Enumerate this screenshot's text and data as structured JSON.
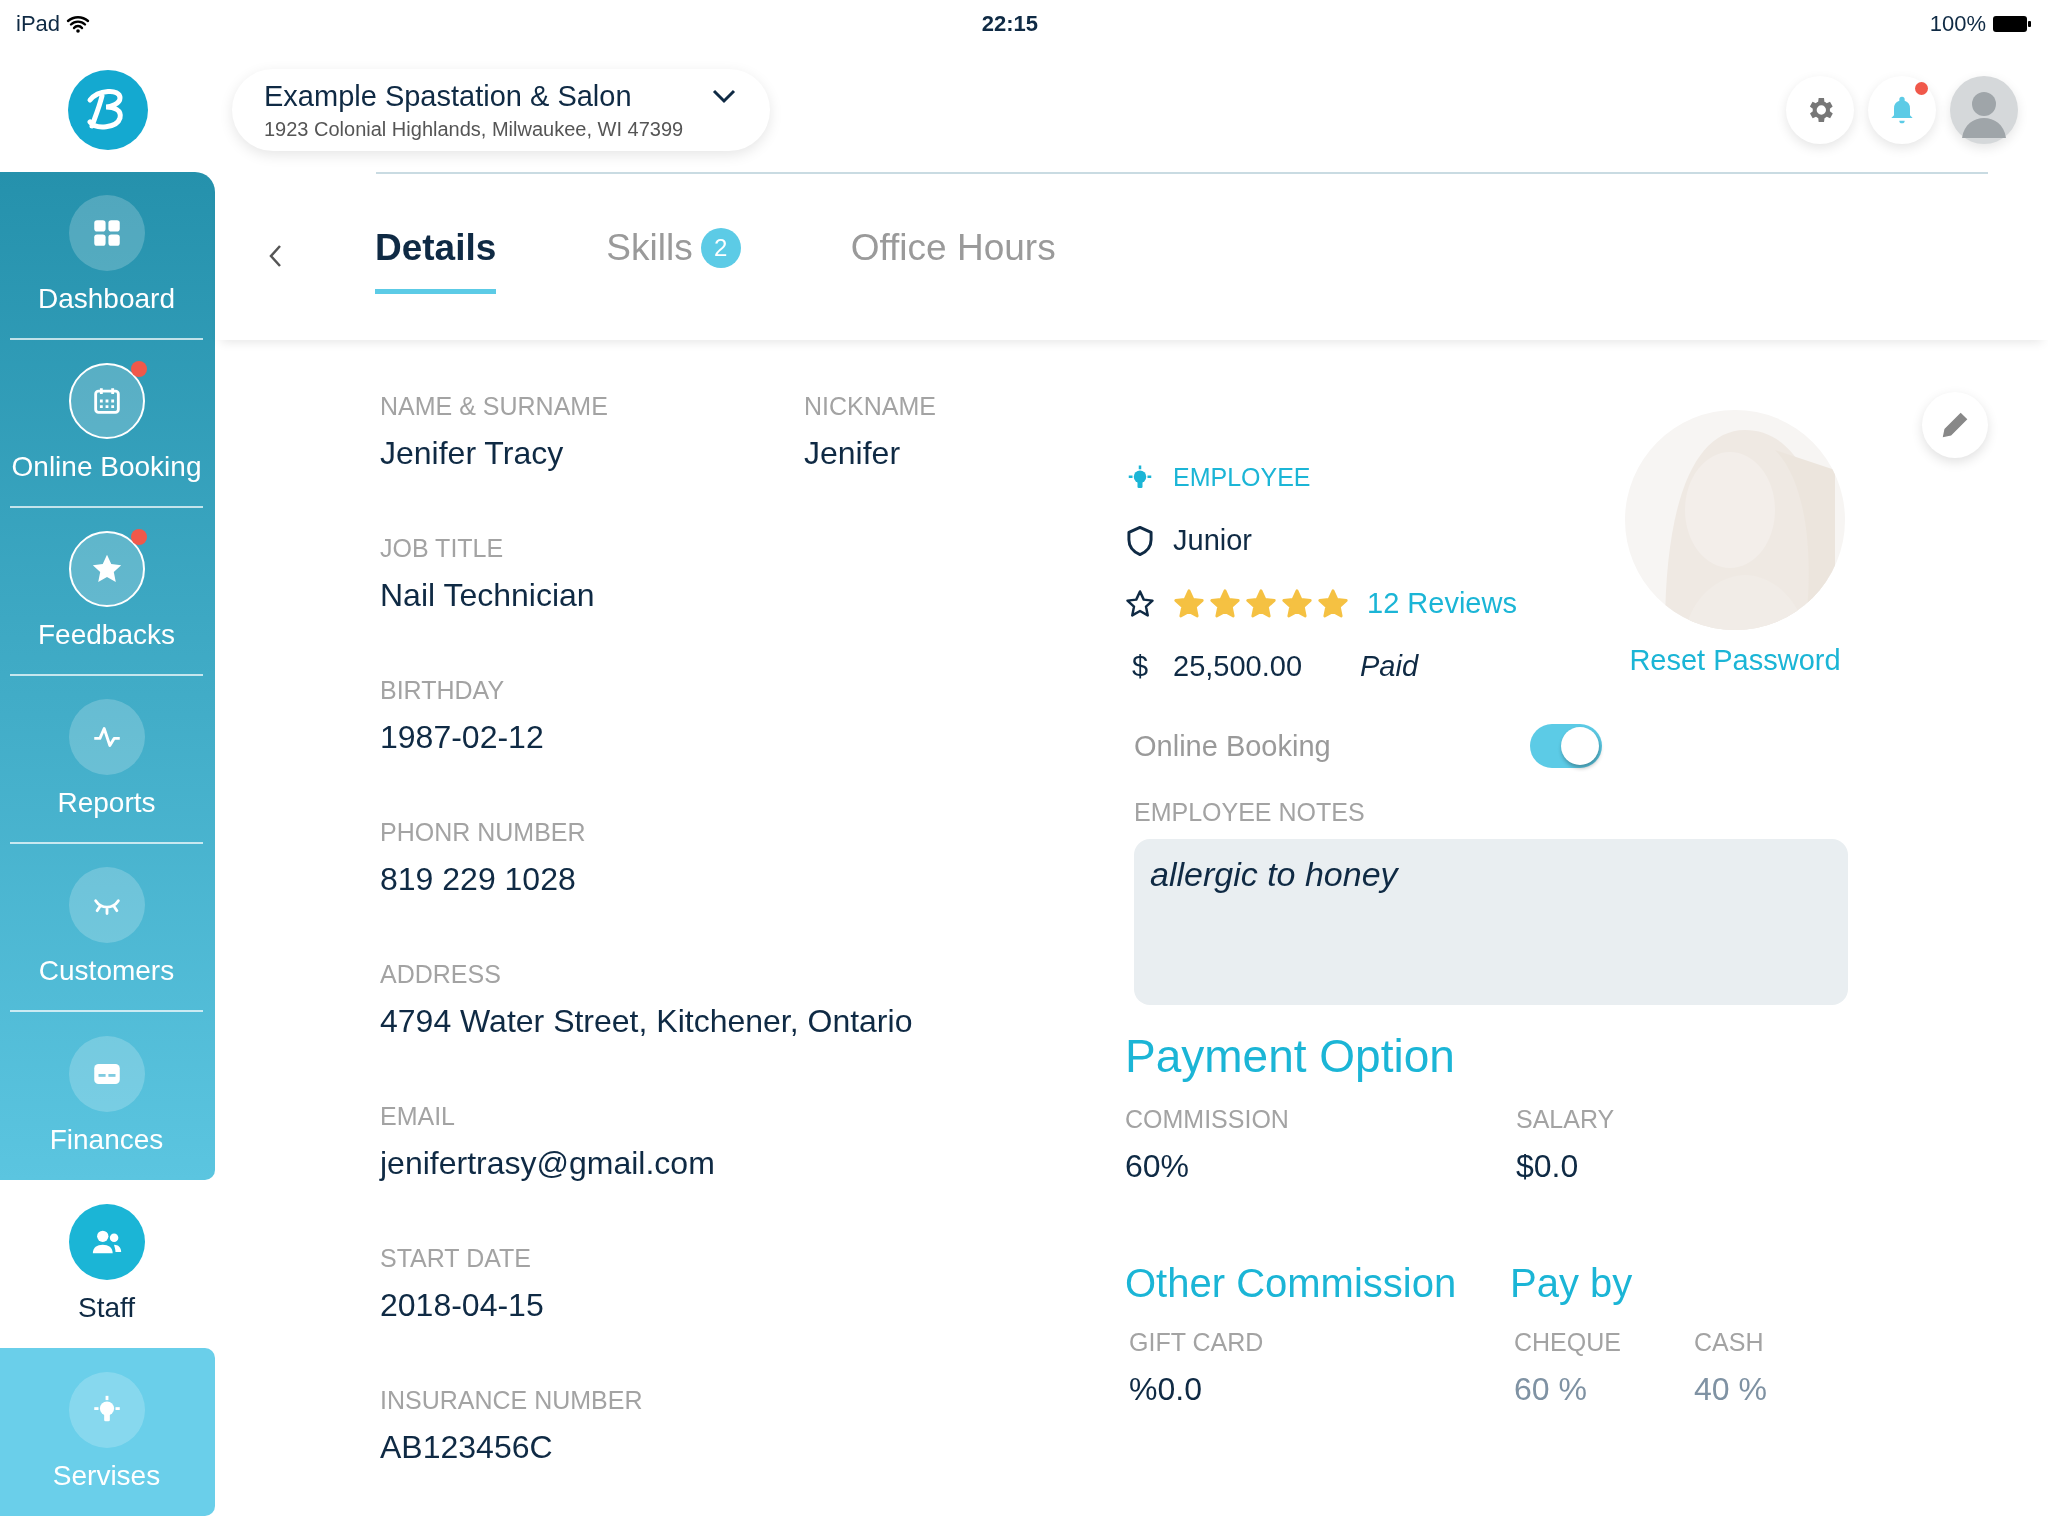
{
  "status_bar": {
    "device": "iPad",
    "time": "22:15",
    "battery": "100%"
  },
  "business": {
    "name": "Example Spastation & Salon",
    "address": "1923 Colonial Highlands, Milwaukee, WI 47399"
  },
  "header": {
    "notifications": true
  },
  "sidebar": {
    "items": [
      {
        "label": "Dashboard",
        "selected": false,
        "notification": false
      },
      {
        "label": "Online Booking",
        "selected": false,
        "notification": true
      },
      {
        "label": "Feedbacks",
        "selected": false,
        "notification": true
      },
      {
        "label": "Reports",
        "selected": false,
        "notification": false
      },
      {
        "label": "Customers",
        "selected": false,
        "notification": false
      },
      {
        "label": "Finances",
        "selected": false,
        "notification": false
      },
      {
        "label": "Staff",
        "selected": true,
        "notification": false
      },
      {
        "label": "Servises",
        "selected": false,
        "notification": false
      }
    ]
  },
  "tabs": [
    {
      "label": "Details",
      "selected": true
    },
    {
      "label": "Skills",
      "selected": false,
      "badge": "2"
    },
    {
      "label": "Office Hours",
      "selected": false
    }
  ],
  "details": {
    "rows": [
      [
        {
          "label": "NAME & SURNAME",
          "value": "Jenifer Tracy"
        },
        {
          "label": "NICKNAME",
          "value": "Jenifer"
        }
      ],
      [
        {
          "label": "JOB TITLE",
          "value": "Nail Technician"
        }
      ],
      [
        {
          "label": "BIRTHDAY",
          "value": "1987-02-12"
        }
      ],
      [
        {
          "label": "PHONR NUMBER",
          "value": "819 229 1028"
        }
      ],
      [
        {
          "label": "ADDRESS",
          "value": "4794 Water Street, Kitchener, Ontario"
        }
      ],
      [
        {
          "label": "EMAIL",
          "value": "jenifertrasy@gmail.com"
        }
      ],
      [
        {
          "label": "START DATE",
          "value": "2018-04-15"
        }
      ],
      [
        {
          "label": "INSURANCE NUMBER",
          "value": "AB123456C"
        }
      ]
    ]
  },
  "profile": {
    "role": "EMPLOYEE",
    "level": "Junior",
    "stars": 5,
    "reviews": "12 Reviews",
    "currency": "$",
    "amount": "25,500.00",
    "status": "Paid",
    "reset_link": "Reset Password"
  },
  "online_booking": {
    "label": "Online Booking",
    "on": true
  },
  "notes": {
    "label": "EMPLOYEE NOTES",
    "value": "allergic to honey"
  },
  "payment": {
    "title": "Payment Option",
    "fields": [
      {
        "label": "COMMISSION",
        "value": "60%"
      },
      {
        "label": "SALARY",
        "value": "$0.0"
      }
    ]
  },
  "other_commission": {
    "title": "Other Commission",
    "fields": [
      {
        "label": "GIFT CARD",
        "value": "%0.0"
      }
    ]
  },
  "pay_by": {
    "title": "Pay by",
    "disabled": true,
    "fields": [
      {
        "label": "CHEQUE",
        "value": "60 %"
      },
      {
        "label": "CASH",
        "value": "40 %"
      }
    ]
  }
}
